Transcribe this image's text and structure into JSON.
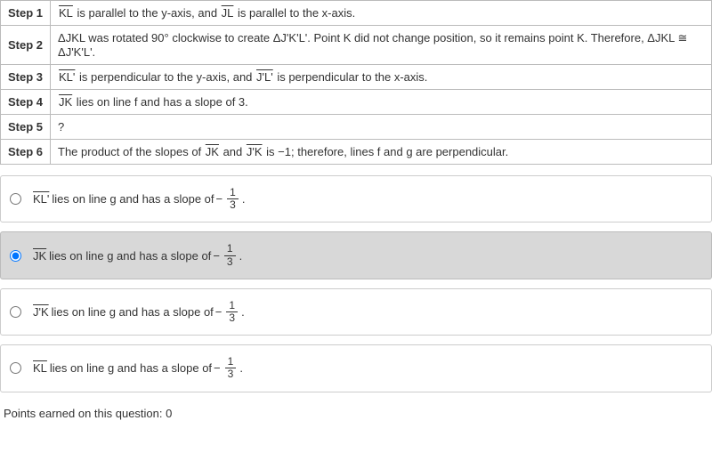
{
  "steps": [
    {
      "label": "Step 1",
      "seg1": "KL",
      "mid1": " is parallel to the y-axis, and ",
      "seg2": "JL",
      "tail": " is parallel to the x-axis."
    },
    {
      "label": "Step 2",
      "text": "ΔJKL was rotated 90° clockwise to create ΔJ'K'L'. Point K did not change position, so it remains point K. Therefore, ΔJKL ≅ ΔJ'K'L'."
    },
    {
      "label": "Step 3",
      "seg1": "KL'",
      "mid1": " is perpendicular to the y-axis, and ",
      "seg2": "J'L'",
      "tail": " is perpendicular to the x-axis."
    },
    {
      "label": "Step 4",
      "seg1": "JK",
      "tail": " lies on line f and has a slope of 3."
    },
    {
      "label": "Step 5",
      "text": "?"
    },
    {
      "label": "Step 6",
      "pre": "The product of the slopes of ",
      "seg1": "JK",
      "mid1": " and ",
      "seg2": "J'K",
      "tail": " is −1; therefore, lines f and g are perpendicular."
    }
  ],
  "options": [
    {
      "seg": "KL'",
      "text": " lies on line g and has a slope of ",
      "neg": "−",
      "num": "1",
      "den": "3",
      "end": "."
    },
    {
      "seg": "JK",
      "text": " lies on line g and has a slope of ",
      "neg": "−",
      "num": "1",
      "den": "3",
      "end": "."
    },
    {
      "seg": "J'K",
      "text": " lies on line g and has a slope of ",
      "neg": "−",
      "num": "1",
      "den": "3",
      "end": "."
    },
    {
      "seg": "KL",
      "text": " lies on line g and has a slope of ",
      "neg": "−",
      "num": "1",
      "den": "3",
      "end": "."
    }
  ],
  "selected_index": 1,
  "points_text": "Points earned on this question: 0"
}
